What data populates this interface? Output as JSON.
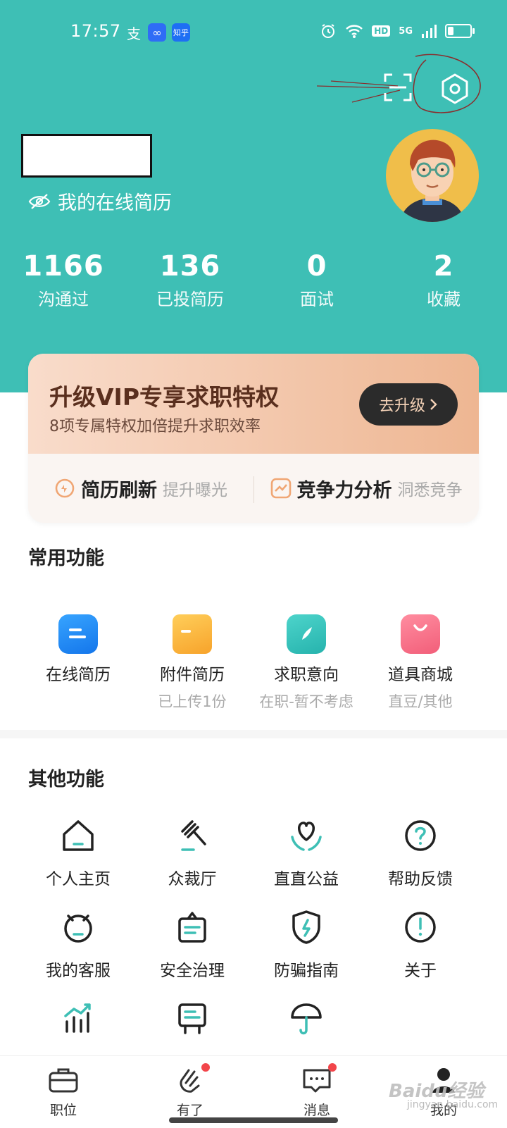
{
  "status_bar": {
    "time": "17:57",
    "apps": [
      "支",
      "∞",
      "知乎"
    ],
    "app_colors": [
      "#3ebfb5",
      "#2f6cf6",
      "#1e6ff4"
    ],
    "hd": "HD",
    "network": "5G"
  },
  "profile": {
    "resume_link": "我的在线简历"
  },
  "stats": [
    {
      "value": "1166",
      "label": "沟通过"
    },
    {
      "value": "136",
      "label": "已投简历"
    },
    {
      "value": "0",
      "label": "面试"
    },
    {
      "value": "2",
      "label": "收藏"
    }
  ],
  "vip": {
    "title": "升级VIP专享求职特权",
    "subtitle": "8项专属特权加倍提升求职效率",
    "button": "去升级",
    "features": [
      {
        "name": "简历刷新",
        "desc": "提升曝光"
      },
      {
        "name": "竞争力分析",
        "desc": "洞悉竞争"
      }
    ]
  },
  "common": {
    "title": "常用功能",
    "items": [
      {
        "label": "在线简历",
        "sub": "",
        "color": "#2a8ef5"
      },
      {
        "label": "附件简历",
        "sub": "已上传1份",
        "color": "#f7b739"
      },
      {
        "label": "求职意向",
        "sub": "在职-暂不考虑",
        "color": "#34c6bf"
      },
      {
        "label": "道具商城",
        "sub": "直豆/其他",
        "color": "#f56f86"
      }
    ]
  },
  "other": {
    "title": "其他功能",
    "items": [
      {
        "label": "个人主页"
      },
      {
        "label": "众裁厅"
      },
      {
        "label": "直直公益"
      },
      {
        "label": "帮助反馈"
      },
      {
        "label": "我的客服"
      },
      {
        "label": "安全治理"
      },
      {
        "label": "防骗指南"
      },
      {
        "label": "关于"
      }
    ]
  },
  "nav": [
    {
      "label": "职位"
    },
    {
      "label": "有了"
    },
    {
      "label": "消息"
    },
    {
      "label": "我的"
    }
  ],
  "watermark": {
    "brand": "Baidu经验",
    "url": "jingyan.baidu.com"
  },
  "colors": {
    "brand": "#3ebfb5",
    "dot": "#f2454a"
  }
}
